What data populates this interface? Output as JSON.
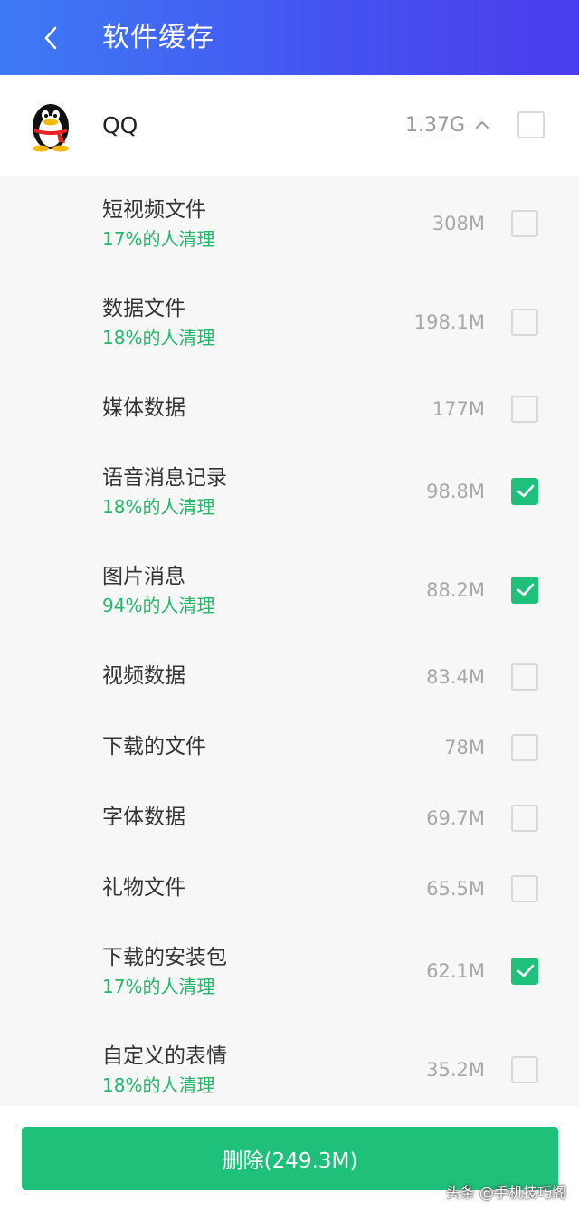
{
  "header": {
    "title": "软件缓存"
  },
  "app": {
    "name": "QQ",
    "size": "1.37G"
  },
  "items": [
    {
      "title": "短视频文件",
      "sub": "17%的人清理",
      "size": "308M",
      "checked": false
    },
    {
      "title": "数据文件",
      "sub": "18%的人清理",
      "size": "198.1M",
      "checked": false
    },
    {
      "title": "媒体数据",
      "sub": "",
      "size": "177M",
      "checked": false
    },
    {
      "title": "语音消息记录",
      "sub": "18%的人清理",
      "size": "98.8M",
      "checked": true
    },
    {
      "title": "图片消息",
      "sub": "94%的人清理",
      "size": "88.2M",
      "checked": true
    },
    {
      "title": "视频数据",
      "sub": "",
      "size": "83.4M",
      "checked": false
    },
    {
      "title": "下载的文件",
      "sub": "",
      "size": "78M",
      "checked": false
    },
    {
      "title": "字体数据",
      "sub": "",
      "size": "69.7M",
      "checked": false
    },
    {
      "title": "礼物文件",
      "sub": "",
      "size": "65.5M",
      "checked": false
    },
    {
      "title": "下载的安装包",
      "sub": "17%的人清理",
      "size": "62.1M",
      "checked": true
    },
    {
      "title": "自定义的表情",
      "sub": "18%的人清理",
      "size": "35.2M",
      "checked": false
    }
  ],
  "footer": {
    "delete_label": "删除(249.3M)"
  },
  "watermark": "头条 @手机技巧阁",
  "colors": {
    "accent": "#1fc07a",
    "header_start": "#3e7bf5",
    "header_end": "#4a3cec"
  }
}
